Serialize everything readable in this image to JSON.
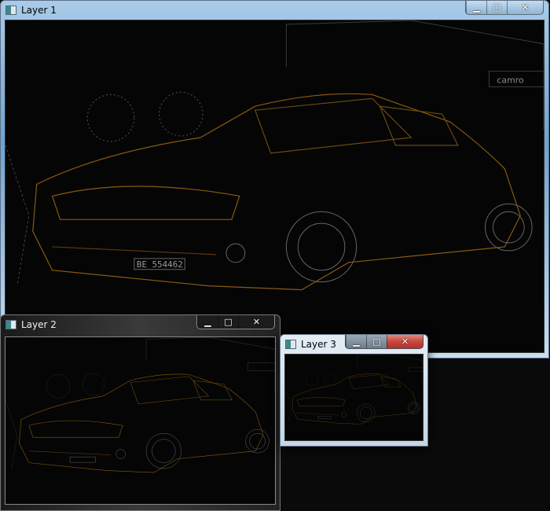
{
  "windows": [
    {
      "title": "Layer 1",
      "active": false,
      "minimize": "▁",
      "maximize": "□",
      "close": "✕"
    },
    {
      "title": "Layer 2",
      "active": false,
      "minimize": "▁",
      "maximize": "□",
      "close": "✕"
    },
    {
      "title": "Layer 3",
      "active": true,
      "minimize": "▁",
      "maximize": "□",
      "close": "✕"
    }
  ],
  "plate_text": "BE 554462",
  "sign_text": "camro",
  "colors": {
    "edge_orange": "#8a5a10",
    "edge_gray": "#4a4a4a",
    "close_active": "#c9463d"
  }
}
